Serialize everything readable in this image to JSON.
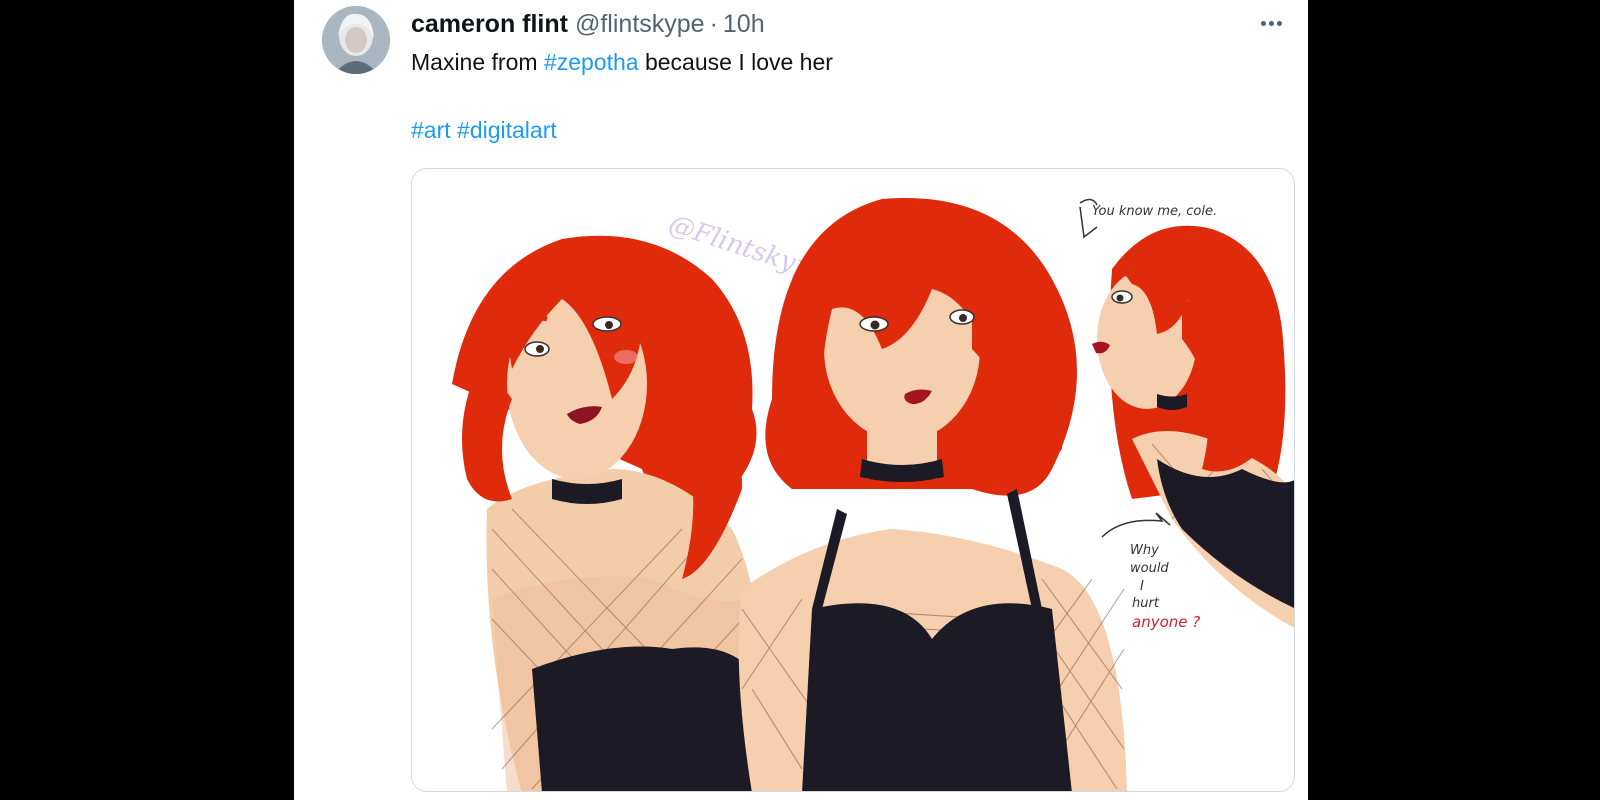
{
  "tweet": {
    "author": {
      "display_name": "cameron flint",
      "handle": "@flintskype",
      "separator": "·",
      "time": "10h"
    },
    "text": {
      "part1": "Maxine from ",
      "hashtag1": "#zepotha",
      "part2": " because I love her",
      "hashtag2": "#art",
      "hashtag3": "#digitalart"
    },
    "media": {
      "watermark": "@Flintskype",
      "caption_top": "You know me, cole.",
      "caption_bottom_lines": [
        "Why",
        "would",
        "I",
        "hurt"
      ],
      "caption_bottom_red": "anyone ?"
    },
    "icons": {
      "more": "more-horizontal-icon"
    }
  },
  "colors": {
    "link": "#1d9bf0",
    "hair": "#e02a0c",
    "skin": "#f6cfae",
    "outfit": "#1c1a24"
  }
}
